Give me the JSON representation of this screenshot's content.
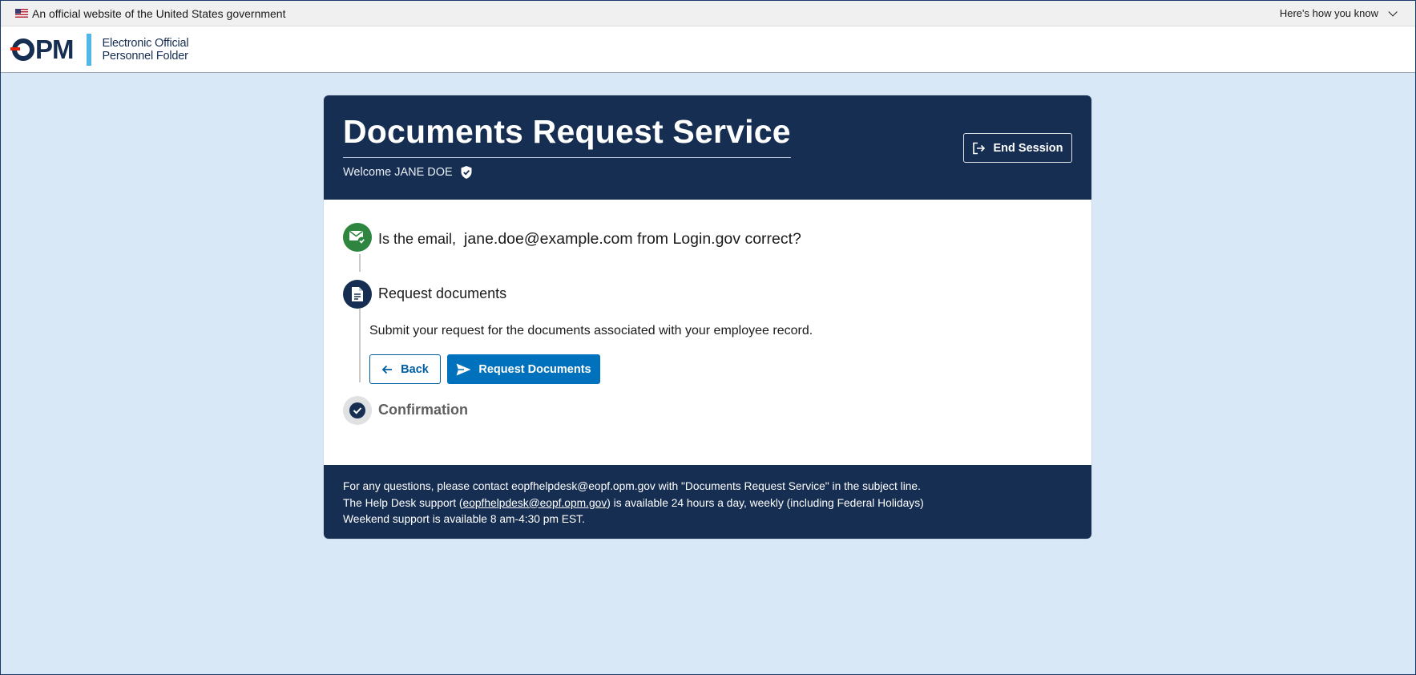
{
  "gov_banner": {
    "text": "An official website of the United States government",
    "how_you_know": "Here's how you know"
  },
  "header": {
    "logo_text": "PM",
    "site_name_line1": "Electronic Official",
    "site_name_line2": "Personnel Folder"
  },
  "card": {
    "title": "Documents Request Service",
    "welcome": "Welcome JANE DOE",
    "end_session": "End Session"
  },
  "steps": {
    "email_question": "Is the email,",
    "email_value": "jane.doe@example.com from Login.gov correct?",
    "request_title": "Request documents",
    "request_desc": "Submit your request for the documents associated with your employee record.",
    "back_label": "Back",
    "request_label": "Request Documents",
    "confirmation_title": "Confirmation"
  },
  "footer": {
    "line1": "For any questions, please contact eopfhelpdesk@eopf.opm.gov with \"Documents Request Service\" in the subject line.",
    "line2_prefix": "The Help Desk support (",
    "line2_link": "eopfhelpdesk@eopf.opm.gov",
    "line2_suffix": ") is available 24 hours a day, weekly (including Federal Holidays)",
    "line3": "Weekend support is available 8 am-4:30 pm EST."
  },
  "colors": {
    "navy": "#162e51",
    "primary_blue": "#0071bc",
    "success_green": "#2e8540",
    "page_bg": "#d9e8f6"
  }
}
